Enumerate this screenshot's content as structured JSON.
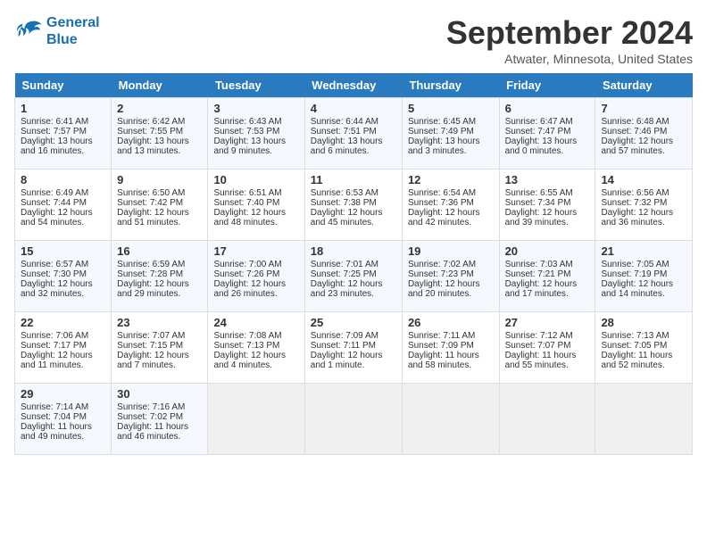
{
  "logo": {
    "line1": "General",
    "line2": "Blue"
  },
  "title": "September 2024",
  "location": "Atwater, Minnesota, United States",
  "days_of_week": [
    "Sunday",
    "Monday",
    "Tuesday",
    "Wednesday",
    "Thursday",
    "Friday",
    "Saturday"
  ],
  "weeks": [
    [
      {
        "day": "1",
        "sunrise": "Sunrise: 6:41 AM",
        "sunset": "Sunset: 7:57 PM",
        "daylight": "Daylight: 13 hours and 16 minutes."
      },
      {
        "day": "2",
        "sunrise": "Sunrise: 6:42 AM",
        "sunset": "Sunset: 7:55 PM",
        "daylight": "Daylight: 13 hours and 13 minutes."
      },
      {
        "day": "3",
        "sunrise": "Sunrise: 6:43 AM",
        "sunset": "Sunset: 7:53 PM",
        "daylight": "Daylight: 13 hours and 9 minutes."
      },
      {
        "day": "4",
        "sunrise": "Sunrise: 6:44 AM",
        "sunset": "Sunset: 7:51 PM",
        "daylight": "Daylight: 13 hours and 6 minutes."
      },
      {
        "day": "5",
        "sunrise": "Sunrise: 6:45 AM",
        "sunset": "Sunset: 7:49 PM",
        "daylight": "Daylight: 13 hours and 3 minutes."
      },
      {
        "day": "6",
        "sunrise": "Sunrise: 6:47 AM",
        "sunset": "Sunset: 7:47 PM",
        "daylight": "Daylight: 13 hours and 0 minutes."
      },
      {
        "day": "7",
        "sunrise": "Sunrise: 6:48 AM",
        "sunset": "Sunset: 7:46 PM",
        "daylight": "Daylight: 12 hours and 57 minutes."
      }
    ],
    [
      {
        "day": "8",
        "sunrise": "Sunrise: 6:49 AM",
        "sunset": "Sunset: 7:44 PM",
        "daylight": "Daylight: 12 hours and 54 minutes."
      },
      {
        "day": "9",
        "sunrise": "Sunrise: 6:50 AM",
        "sunset": "Sunset: 7:42 PM",
        "daylight": "Daylight: 12 hours and 51 minutes."
      },
      {
        "day": "10",
        "sunrise": "Sunrise: 6:51 AM",
        "sunset": "Sunset: 7:40 PM",
        "daylight": "Daylight: 12 hours and 48 minutes."
      },
      {
        "day": "11",
        "sunrise": "Sunrise: 6:53 AM",
        "sunset": "Sunset: 7:38 PM",
        "daylight": "Daylight: 12 hours and 45 minutes."
      },
      {
        "day": "12",
        "sunrise": "Sunrise: 6:54 AM",
        "sunset": "Sunset: 7:36 PM",
        "daylight": "Daylight: 12 hours and 42 minutes."
      },
      {
        "day": "13",
        "sunrise": "Sunrise: 6:55 AM",
        "sunset": "Sunset: 7:34 PM",
        "daylight": "Daylight: 12 hours and 39 minutes."
      },
      {
        "day": "14",
        "sunrise": "Sunrise: 6:56 AM",
        "sunset": "Sunset: 7:32 PM",
        "daylight": "Daylight: 12 hours and 36 minutes."
      }
    ],
    [
      {
        "day": "15",
        "sunrise": "Sunrise: 6:57 AM",
        "sunset": "Sunset: 7:30 PM",
        "daylight": "Daylight: 12 hours and 32 minutes."
      },
      {
        "day": "16",
        "sunrise": "Sunrise: 6:59 AM",
        "sunset": "Sunset: 7:28 PM",
        "daylight": "Daylight: 12 hours and 29 minutes."
      },
      {
        "day": "17",
        "sunrise": "Sunrise: 7:00 AM",
        "sunset": "Sunset: 7:26 PM",
        "daylight": "Daylight: 12 hours and 26 minutes."
      },
      {
        "day": "18",
        "sunrise": "Sunrise: 7:01 AM",
        "sunset": "Sunset: 7:25 PM",
        "daylight": "Daylight: 12 hours and 23 minutes."
      },
      {
        "day": "19",
        "sunrise": "Sunrise: 7:02 AM",
        "sunset": "Sunset: 7:23 PM",
        "daylight": "Daylight: 12 hours and 20 minutes."
      },
      {
        "day": "20",
        "sunrise": "Sunrise: 7:03 AM",
        "sunset": "Sunset: 7:21 PM",
        "daylight": "Daylight: 12 hours and 17 minutes."
      },
      {
        "day": "21",
        "sunrise": "Sunrise: 7:05 AM",
        "sunset": "Sunset: 7:19 PM",
        "daylight": "Daylight: 12 hours and 14 minutes."
      }
    ],
    [
      {
        "day": "22",
        "sunrise": "Sunrise: 7:06 AM",
        "sunset": "Sunset: 7:17 PM",
        "daylight": "Daylight: 12 hours and 11 minutes."
      },
      {
        "day": "23",
        "sunrise": "Sunrise: 7:07 AM",
        "sunset": "Sunset: 7:15 PM",
        "daylight": "Daylight: 12 hours and 7 minutes."
      },
      {
        "day": "24",
        "sunrise": "Sunrise: 7:08 AM",
        "sunset": "Sunset: 7:13 PM",
        "daylight": "Daylight: 12 hours and 4 minutes."
      },
      {
        "day": "25",
        "sunrise": "Sunrise: 7:09 AM",
        "sunset": "Sunset: 7:11 PM",
        "daylight": "Daylight: 12 hours and 1 minute."
      },
      {
        "day": "26",
        "sunrise": "Sunrise: 7:11 AM",
        "sunset": "Sunset: 7:09 PM",
        "daylight": "Daylight: 11 hours and 58 minutes."
      },
      {
        "day": "27",
        "sunrise": "Sunrise: 7:12 AM",
        "sunset": "Sunset: 7:07 PM",
        "daylight": "Daylight: 11 hours and 55 minutes."
      },
      {
        "day": "28",
        "sunrise": "Sunrise: 7:13 AM",
        "sunset": "Sunset: 7:05 PM",
        "daylight": "Daylight: 11 hours and 52 minutes."
      }
    ],
    [
      {
        "day": "29",
        "sunrise": "Sunrise: 7:14 AM",
        "sunset": "Sunset: 7:04 PM",
        "daylight": "Daylight: 11 hours and 49 minutes."
      },
      {
        "day": "30",
        "sunrise": "Sunrise: 7:16 AM",
        "sunset": "Sunset: 7:02 PM",
        "daylight": "Daylight: 11 hours and 46 minutes."
      },
      null,
      null,
      null,
      null,
      null
    ]
  ]
}
